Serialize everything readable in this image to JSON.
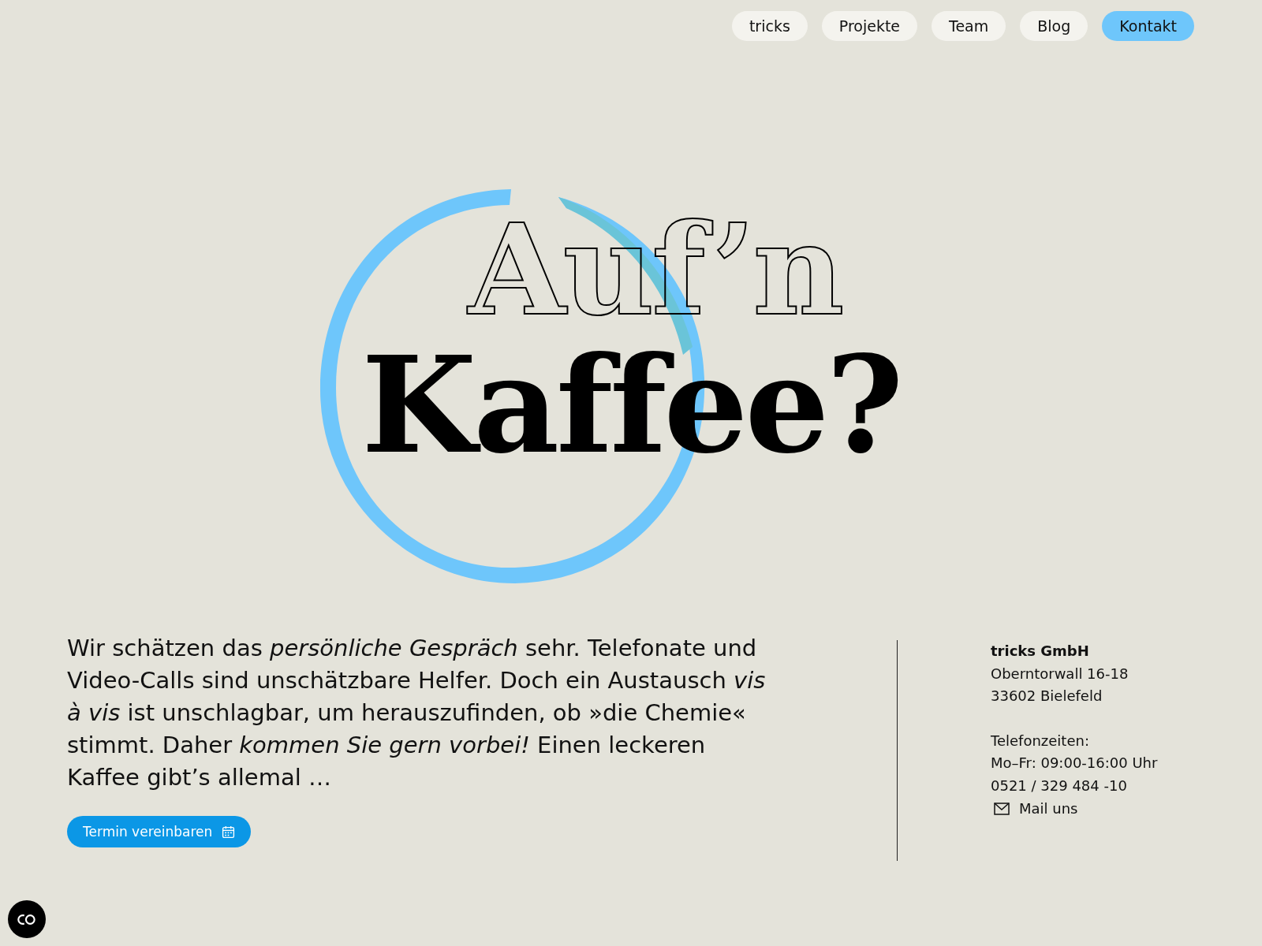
{
  "nav": [
    {
      "label": "tricks",
      "selected": false
    },
    {
      "label": "Projekte",
      "selected": false
    },
    {
      "label": "Team",
      "selected": false
    },
    {
      "label": "Blog",
      "selected": false
    },
    {
      "label": "Kontakt",
      "selected": true
    }
  ],
  "headline": [
    {
      "text": "Auf’n",
      "kind": "outline"
    },
    {
      "text": "Kaffee?",
      "kind": "solid"
    }
  ],
  "intro": "Wir schätzen das *persönliche Gespräch* sehr. Telefonate und Video-Calls sind unschätzbare Helfer. Doch ein Austausch *vis à vis* ist unschlagbar, um herauszufinden, ob »die Chemie« stimmt. Daher *kommen Sie gern vorbei!* Einen leckeren Kaffee gibt’s allemal …",
  "cta": {
    "label": "Termin vereinbaren"
  },
  "contact": {
    "company": "tricks GmbH",
    "address": [
      "Oberntorwall 16-18",
      "33602 Bielefeld"
    ],
    "hours_label": "Telefonzeiten:",
    "hours": "Mo–Fr: 09:00-16:00 Uhr",
    "phone": "0521 / 329 484 -10",
    "mail": "Mail uns"
  }
}
